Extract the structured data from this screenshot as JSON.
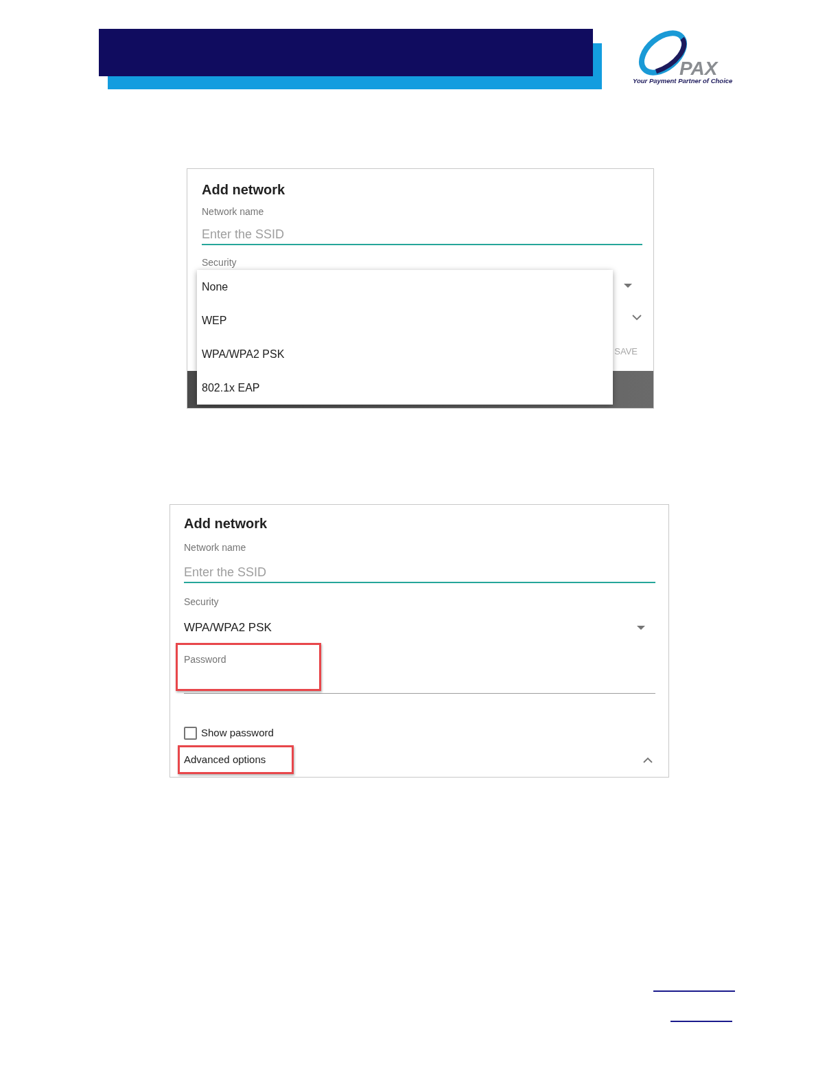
{
  "header": {
    "logo_word": "PAX",
    "logo_tagline": "Your Payment Partner of Choice"
  },
  "dialog_with_menu": {
    "title": "Add network",
    "network_name_label": "Network name",
    "network_name_placeholder": "Enter the SSID",
    "security_label": "Security",
    "save_button": "SAVE",
    "security_menu": [
      {
        "label": "None",
        "selected": false
      },
      {
        "label": "WEP",
        "selected": false
      },
      {
        "label": "WPA/WPA2 PSK",
        "selected": false
      },
      {
        "label": "802.1x EAP",
        "selected": false
      }
    ]
  },
  "dialog_filled": {
    "title": "Add network",
    "network_name_label": "Network name",
    "network_name_placeholder": "Enter the SSID",
    "security_label": "Security",
    "security_value": "WPA/WPA2 PSK",
    "password": {
      "label": "Password",
      "highlighted": true
    },
    "show_password": {
      "label": "Show password",
      "checked": false
    },
    "advanced_options": {
      "label": "Advanced options",
      "expanded": true,
      "highlighted": true
    }
  }
}
